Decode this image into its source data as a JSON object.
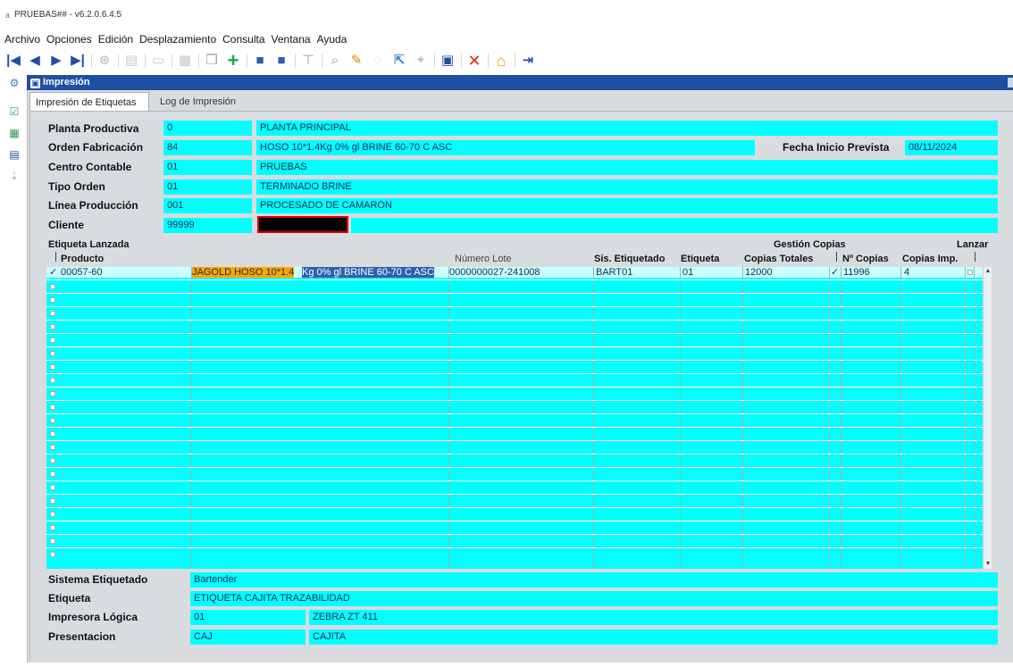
{
  "window": {
    "title": "PRUEBAS## - v6.2.0.6.4.5",
    "app_icon": "a"
  },
  "menu": [
    "Archivo",
    "Opciones",
    "Edición",
    "Desplazamiento",
    "Consulta",
    "Ventana",
    "Ayuda"
  ],
  "toolbar": {
    "first": "|◀",
    "prev": "◀",
    "next": "▶",
    "last": "▶|",
    "refresh": "⊛",
    "print": "▤",
    "frame": "▭",
    "grid": "▦",
    "copy": "❐",
    "add": "+",
    "db1": "■",
    "db2": "■",
    "filter": "⊤",
    "zoom": "⌕",
    "edit": "✎",
    "clear": "◌",
    "export": "⇱",
    "wand": "✦",
    "save": "▣",
    "delete": "✕",
    "home": "⌂",
    "exit": "⇥"
  },
  "leftbar": {
    "settings": "⚙",
    "check": "☑",
    "grid": "▦",
    "printer": "▤",
    "pin": "⇣"
  },
  "form": {
    "header_title": "Impresión",
    "tabs": [
      "Impresión de Etiquetas",
      "Log de Impresión"
    ],
    "planta": {
      "label": "Planta Productiva",
      "code": "0",
      "name": "PLANTA PRINCIPAL"
    },
    "orden": {
      "label": "Orden Fabricación",
      "code": "84",
      "name": "HOSO 10*1.4Kg 0% gl BRINE 60-70 C ASC"
    },
    "fecha": {
      "label": "Fecha Inicio Prevista",
      "value": "08/11/2024"
    },
    "centro": {
      "label": "Centro Contable",
      "code": "01",
      "name": "PRUEBAS"
    },
    "tipo": {
      "label": "Tipo Orden",
      "code": "01",
      "name": "TERMINADO BRINE"
    },
    "linea": {
      "label": "Línea Producción",
      "code": "001",
      "name": "PROCESADO DE CAMARON"
    },
    "cliente": {
      "label": "Cliente",
      "code": "99999"
    }
  },
  "grid": {
    "title": "Etiqueta Lanzada",
    "groups": {
      "gestion": "Gestión Copias",
      "lanzar": "Lanzar"
    },
    "headers": {
      "producto": "Producto",
      "lote": "Número Lote",
      "sis": "Sis. Etiquetado",
      "etq": "Etiqueta",
      "copias_tot": "Copias Totales",
      "n_copias": "Nº Copias",
      "copias_imp": "Copias Imp."
    },
    "row": {
      "check": "✓",
      "code": "00057-60",
      "desc_a": "JAGOLD HOSO 10*1.4",
      "desc_b": "Kg 0% gl BRINE 60-70 C ASC",
      "lote": "0000000027-241008",
      "sis": "BART01",
      "etq": "01",
      "copias_tot": "12000",
      "check2": "✓",
      "n_copias": "11996",
      "copias_imp": "4"
    }
  },
  "footer": {
    "sistema": {
      "label": "Sistema Etiquetado",
      "value": "Bartender"
    },
    "etiqueta": {
      "label": "Etiqueta",
      "value": "ETIQUETA CAJITA TRAZABILIDAD"
    },
    "impresora": {
      "label": "Impresora Lógica",
      "code": "01",
      "name": "ZEBRA ZT 411"
    },
    "presentacion": {
      "label": "Presentacion",
      "code": "CAJ",
      "name": "CAJITA"
    }
  },
  "colors": {
    "field": "#00ffff",
    "header_bar": "#1e4fa3",
    "panel": "#d9dcdf",
    "highlight": "#ffa500",
    "selection": "#2f5fb0"
  }
}
